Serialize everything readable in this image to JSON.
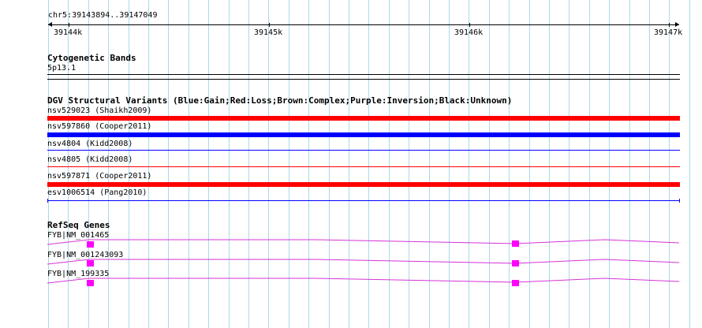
{
  "colors": {
    "grid": "#a8dbe9",
    "gain": "#0000ff",
    "loss": "#ff0000",
    "gene": "#d633d6",
    "exon": "#ff00ff"
  },
  "ruler": {
    "range_label": "chr5:39143894..39147049",
    "ticks": [
      "39144k",
      "39145k",
      "39146k",
      "39147k"
    ]
  },
  "cytoband": {
    "title": "Cytogenetic Bands",
    "band_label": "5p13.1"
  },
  "dgv": {
    "title": "DGV Structural Variants (Blue:Gain;Red:Loss;Brown:Complex;Purple:Inversion;Black:Unknown)",
    "variants": [
      {
        "label": "nsv529023 (Shaikh2009)",
        "type": "loss",
        "style": "thick"
      },
      {
        "label": "nsv597860 (Cooper2011)",
        "type": "gain",
        "style": "thick"
      },
      {
        "label": "nsv4804 (Kidd2008)",
        "type": "gain",
        "style": "thin"
      },
      {
        "label": "nsv4805 (Kidd2008)",
        "type": "loss",
        "style": "thin"
      },
      {
        "label": "nsv597871 (Cooper2011)",
        "type": "loss",
        "style": "thick"
      },
      {
        "label": "esv1006514 (Pang2010)",
        "type": "gain",
        "style": "bracket"
      }
    ]
  },
  "refseq": {
    "title": "RefSeq Genes",
    "genes": [
      {
        "label": "FYB|NM_001465"
      },
      {
        "label": "FYB|NM_001243093"
      },
      {
        "label": "FYB|NM_199335"
      }
    ]
  }
}
